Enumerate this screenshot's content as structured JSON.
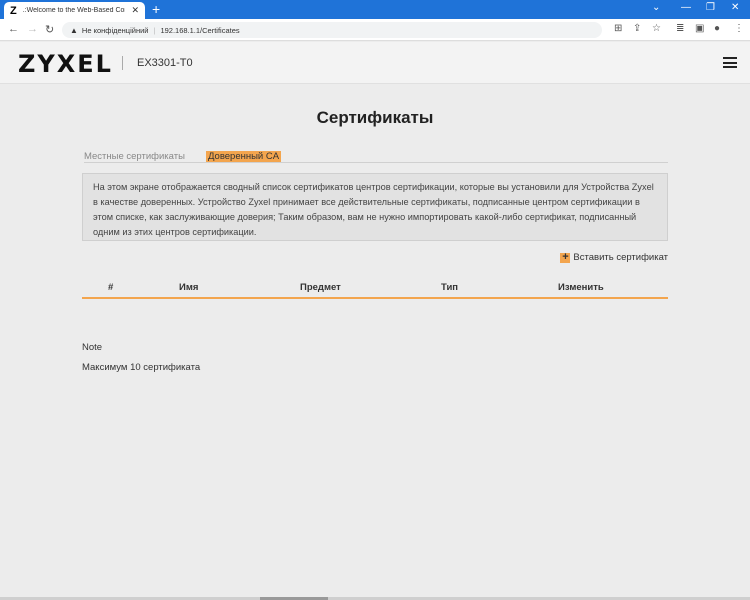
{
  "browser": {
    "tab_title": ".:Welcome to the Web-Based Configurator::",
    "tab_favicon": "Z",
    "new_tab": "+",
    "address": {
      "security_label": "Не конфіденційний",
      "url": "192.168.1.1/Certificates"
    },
    "icons": {
      "back": "back-arrow-icon",
      "forward": "forward-arrow-icon",
      "reload": "reload-icon",
      "warning": "warning-icon",
      "translate": "translate-icon",
      "share": "share-icon",
      "star": "star-icon",
      "reading_list": "reading-list-icon",
      "side_panel": "side-panel-icon",
      "profile": "profile-icon",
      "menu": "more-vert-icon"
    }
  },
  "header": {
    "logo": "ZYXEL",
    "model": "EX3301-T0",
    "menu_icon": "hamburger-icon"
  },
  "page": {
    "title": "Сертификаты",
    "tabs": [
      {
        "label": "Местные сертификаты",
        "active": false
      },
      {
        "label": "Доверенный CA",
        "active": true
      }
    ],
    "info_text": "На этом экране отображается сводный список сертификатов центров сертификации, которые вы установили для Устройства Zyxel в качестве доверенных. Устройство Zyxel принимает все действительные сертификаты, подписанные центром сертификации в этом списке, как заслуживающие доверия; Таким образом, вам не нужно импортировать какой-либо сертификат, подписанный одним из этих центров сертификации.",
    "insert_label": "Вставить сертификат",
    "table": {
      "columns": [
        "#",
        "Имя",
        "Предмет",
        "Тип",
        "Изменить"
      ],
      "rows": []
    },
    "note_label": "Note",
    "note_text": "Максимум 10 сертификата"
  },
  "colors": {
    "accent": "#f3a54e",
    "browser_blue": "#1f73d8",
    "background": "#ececec"
  }
}
